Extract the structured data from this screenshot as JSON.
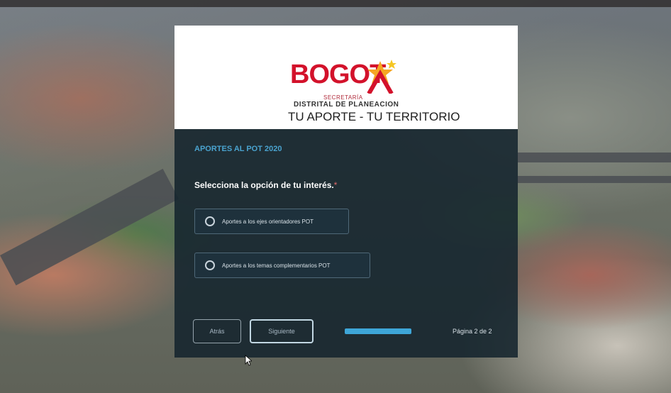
{
  "logo": {
    "word": "BOGOT",
    "secretaria": "SECRETARÍA",
    "distrital": "DISTRITAL DE PLANEACION",
    "tagline": "TU APORTE - TU TERRITORIO"
  },
  "form": {
    "section_title": "APORTES AL POT 2020",
    "question": "Selecciona la opción de tu interés.",
    "required_mark": "*",
    "options": [
      {
        "label": "Aportes a los ejes orientadores POT",
        "selected": false
      },
      {
        "label": "Aportes a los temas complementarios POT",
        "selected": false
      }
    ],
    "back_label": "Atrás",
    "next_label": "Siguiente",
    "progress": 1.0,
    "page_label": "Página 2 de 2"
  },
  "colors": {
    "brand_red": "#d3122b",
    "star_yellow": "#f5a623",
    "accent_blue": "#3ea6d8",
    "panel_bg": "#14242e"
  }
}
